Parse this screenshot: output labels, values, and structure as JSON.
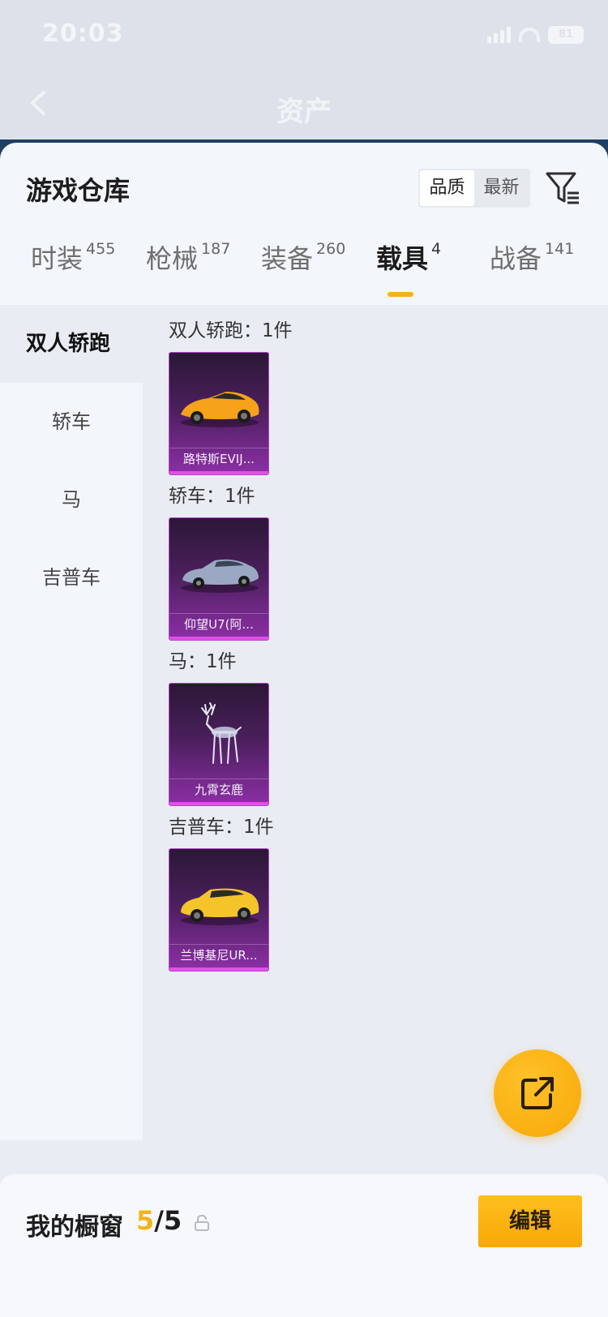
{
  "status_bar": {
    "time": "20:03",
    "battery": "81"
  },
  "header": {
    "title": "资产"
  },
  "warehouse": {
    "title": "游戏仓库",
    "sort_options": [
      "品质",
      "最新"
    ],
    "active_sort": "品质"
  },
  "tabs": [
    {
      "label": "时装",
      "count": "455"
    },
    {
      "label": "枪械",
      "count": "187"
    },
    {
      "label": "装备",
      "count": "260"
    },
    {
      "label": "载具",
      "count": "4",
      "active": true
    },
    {
      "label": "战备",
      "count": "141"
    }
  ],
  "categories": [
    "双人轿跑",
    "轿车",
    "马",
    "吉普车"
  ],
  "active_category": "双人轿跑",
  "groups": [
    {
      "header": "双人轿跑：1件",
      "item": {
        "name": "路特斯EVIJ...",
        "icon": "sports-car-icon"
      }
    },
    {
      "header": "轿车：1件",
      "item": {
        "name": "仰望U7(阿...",
        "icon": "sedan-car-icon"
      }
    },
    {
      "header": "马：1件",
      "item": {
        "name": "九霄玄鹿",
        "icon": "crystal-deer-icon"
      }
    },
    {
      "header": "吉普车：1件",
      "item": {
        "name": "兰博基尼UR...",
        "icon": "suv-icon"
      }
    }
  ],
  "showcase": {
    "title": "我的橱窗",
    "current": "5",
    "total": "/5",
    "edit_label": "编辑"
  },
  "colors": {
    "accent": "#f6b21b",
    "card_purple": "#8d2fa6"
  }
}
